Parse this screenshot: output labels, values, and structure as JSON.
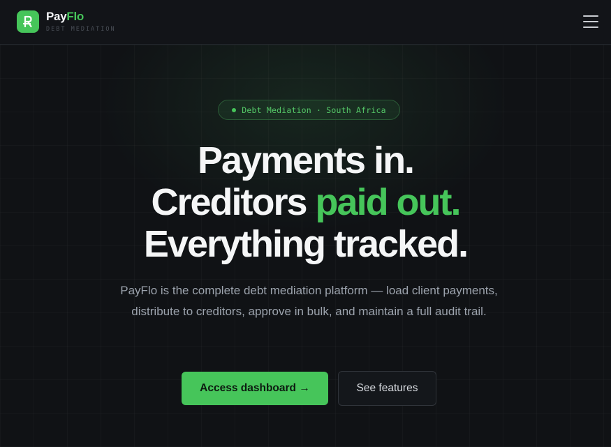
{
  "header": {
    "brand_part1": "Pay",
    "brand_part2": "Flo",
    "brand_subtitle": "DEBT MEDIATION",
    "logo_icon": "rand-r-icon",
    "menu_icon": "hamburger-menu-icon"
  },
  "hero": {
    "badge": "Debt Mediation · South Africa",
    "headline_line1": "Payments in.",
    "headline_line2_white": "Creditors ",
    "headline_line2_green": "paid out.",
    "headline_line3": "Everything tracked.",
    "lead": "PayFlo is the complete debt mediation platform — load client payments, distribute to creditors, approve in bulk, and maintain a full audit trail.",
    "primary_cta": "Access dashboard →",
    "secondary_cta": "See features"
  },
  "colors": {
    "accent": "#46c55a",
    "background": "#101215",
    "text": "#f5f6f7",
    "muted": "#9ca3ad"
  }
}
